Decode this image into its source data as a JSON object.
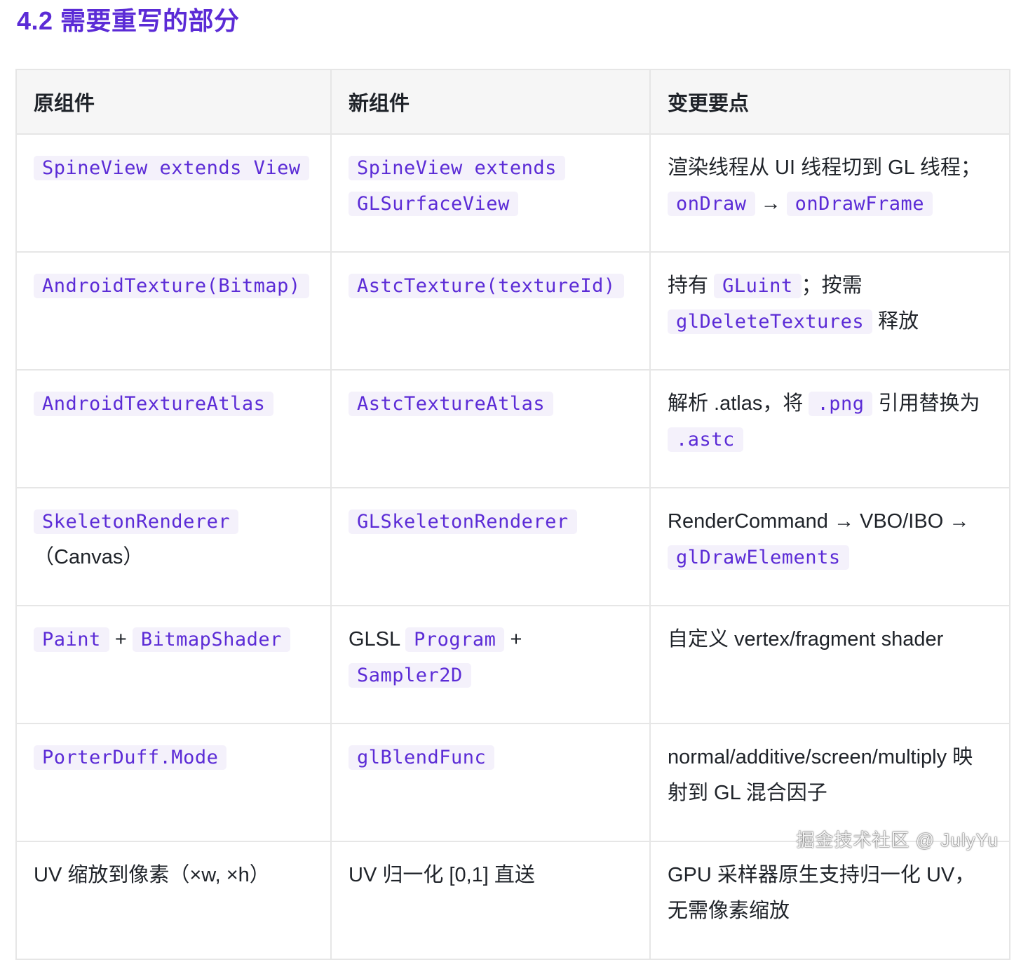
{
  "heading": "4.2 需要重写的部分",
  "table": {
    "headers": [
      "原组件",
      "新组件",
      "变更要点"
    ],
    "rows": [
      {
        "orig": {
          "code1": "SpineView extends View"
        },
        "new": {
          "code1": "SpineView extends",
          "code2": "GLSurfaceView"
        },
        "note": {
          "text1": "渲染线程从 UI 线程切到 GL 线程；",
          "code1": "onDraw",
          "arrow": " → ",
          "code2": "onDrawFrame"
        }
      },
      {
        "orig": {
          "code1": "AndroidTexture(Bitmap)"
        },
        "new": {
          "code1": "AstcTexture(textureId)"
        },
        "note": {
          "text1": "持有 ",
          "code1": "GLuint",
          "text2": "；按需 ",
          "code2": "glDeleteTextures",
          "text3": " 释放"
        }
      },
      {
        "orig": {
          "code1": "AndroidTextureAtlas"
        },
        "new": {
          "code1": "AstcTextureAtlas"
        },
        "note": {
          "text1": "解析 .atlas，将 ",
          "code1": ".png",
          "text2": " 引用替换为 ",
          "code2": ".astc"
        }
      },
      {
        "orig": {
          "code1": "SkeletonRenderer",
          "text1": "（Canvas）"
        },
        "new": {
          "code1": "GLSkeletonRenderer"
        },
        "note": {
          "text1": "RenderCommand → VBO/IBO → ",
          "code1": "glDrawElements"
        }
      },
      {
        "orig": {
          "code1": "Paint",
          "text1": " + ",
          "code2": "BitmapShader"
        },
        "new": {
          "text1": "GLSL ",
          "code1": "Program",
          "text2": " + ",
          "code2": "Sampler2D"
        },
        "note": {
          "text1": "自定义 vertex/fragment shader"
        }
      },
      {
        "orig": {
          "code1": "PorterDuff.Mode"
        },
        "new": {
          "code1": "glBlendFunc"
        },
        "note": {
          "text1": "normal/additive/screen/multiply 映射到 GL 混合因子"
        }
      },
      {
        "orig": {
          "text1": "UV 缩放到像素（×w, ×h）"
        },
        "new": {
          "text1": "UV 归一化 [0,1] 直送"
        },
        "note": {
          "text1": "GPU 采样器原生支持归一化 UV，无需像素缩放"
        }
      }
    ]
  },
  "watermark": "掘金技术社区 @ JulyYu",
  "colors": {
    "accent": "#5b2bd6",
    "code_bg": "#f4f1fb",
    "header_bg": "#f6f6f6",
    "border": "#e6e6e6"
  }
}
